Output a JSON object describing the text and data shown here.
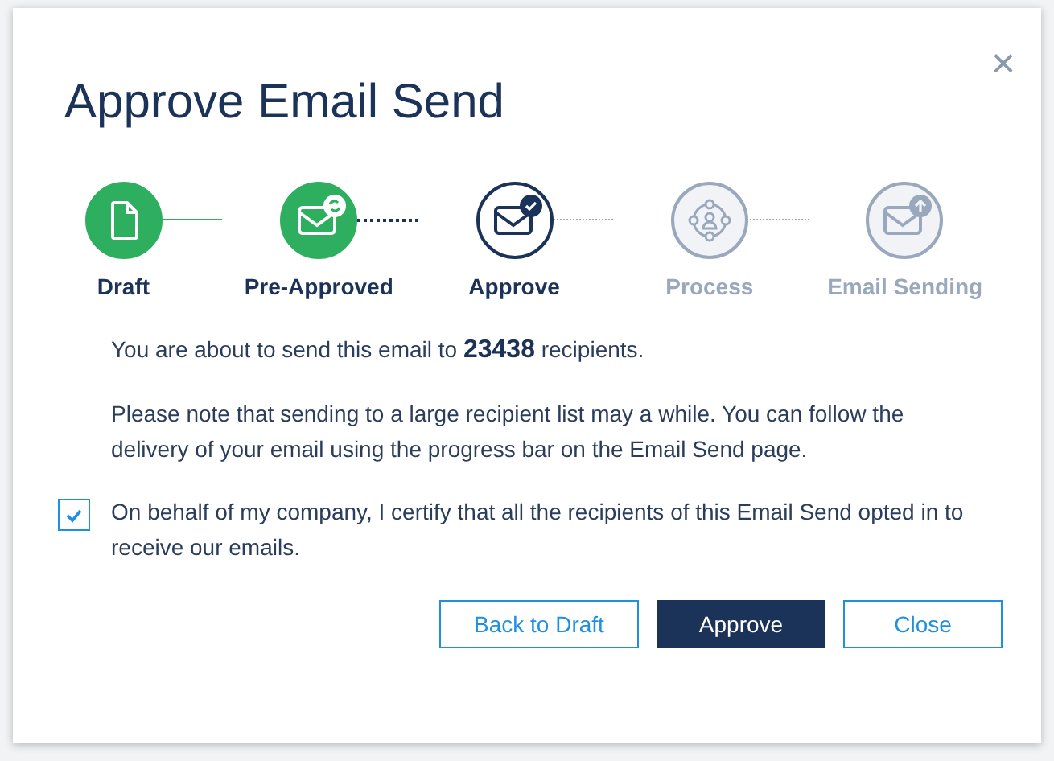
{
  "dialog": {
    "title": "Approve Email Send",
    "close": "×"
  },
  "steps": [
    {
      "label": "Draft",
      "completed": true,
      "current": false
    },
    {
      "label": "Pre-Approved",
      "completed": true,
      "current": false
    },
    {
      "label": "Approve",
      "completed": false,
      "current": true
    },
    {
      "label": "Process",
      "completed": false,
      "current": false
    },
    {
      "label": "Email Sending",
      "completed": false,
      "current": false
    }
  ],
  "summary": "You are about to send this email to **23438** recipients.",
  "note": "Please note that sending to a large recipient list may a while. You can follow the delivery of your email using the progress bar on the Email Send page.",
  "certify": {
    "label": "On behalf of my company, I certify that all the recipients of this Email Send opted in to receive our emails.",
    "checked": true
  },
  "buttons": [
    {
      "label": "Back to Draft",
      "kind": "outline"
    },
    {
      "label": "Approve",
      "kind": "primary"
    },
    {
      "label": "Close",
      "kind": "outline"
    }
  ]
}
